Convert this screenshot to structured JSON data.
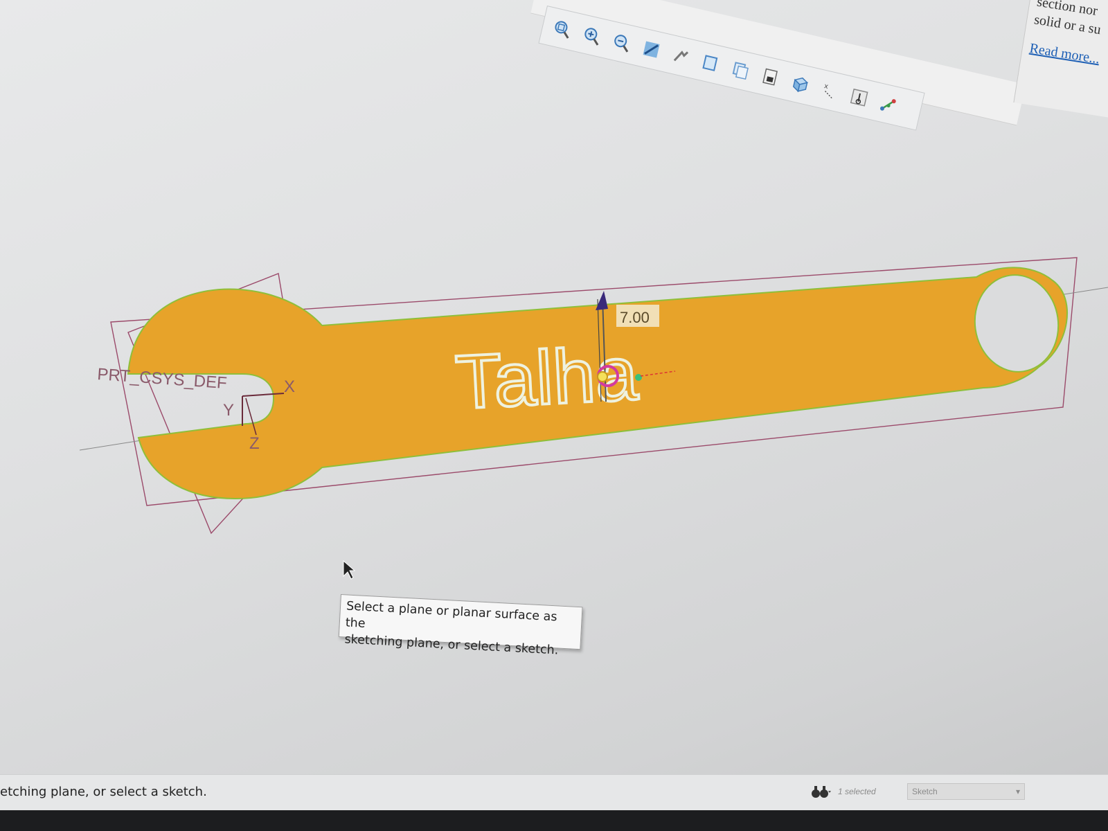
{
  "help_panel": {
    "lines": [
      "section nor",
      "solid or a su"
    ],
    "read_more": "Read more..."
  },
  "toolbar": {
    "icons": [
      "zoom-fit-icon",
      "zoom-in-icon",
      "zoom-out-icon",
      "repaint-icon",
      "pan-icon",
      "saved-view-icon",
      "view-manager-icon",
      "display-style-icon",
      "perspective-icon",
      "datum-display-icon",
      "csys-display-icon",
      "spin-center-icon"
    ]
  },
  "model": {
    "dimension_value": "7.00",
    "emboss_text": "Talha",
    "csys_name": "PRT_CSYS_DEF",
    "axis_x": "X",
    "axis_y": "Y",
    "axis_z": "Z",
    "part_color": "#e7a32a",
    "outline_color": "#9c3a5a"
  },
  "tooltip": {
    "line1": "Select a plane or planar surface as the",
    "line2": "sketching plane, or select a sketch."
  },
  "status_bar": {
    "message": "etching plane, or select a sketch.",
    "selected": "1 selected",
    "filter": "Sketch"
  }
}
